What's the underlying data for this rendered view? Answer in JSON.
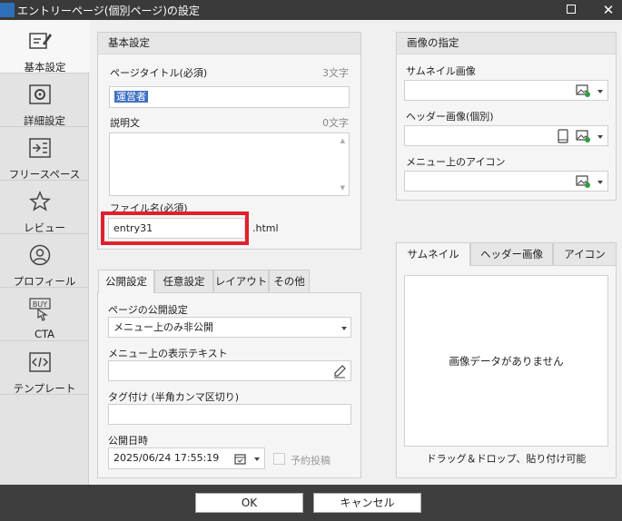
{
  "window": {
    "title": "エントリーページ(個別ページ)の設定"
  },
  "sidebar": {
    "items": [
      {
        "label": "基本設定"
      },
      {
        "label": "詳細設定"
      },
      {
        "label": "フリースペース"
      },
      {
        "label": "レビュー"
      },
      {
        "label": "プロフィール"
      },
      {
        "label": "CTA"
      },
      {
        "label": "テンプレート"
      }
    ]
  },
  "basic": {
    "heading": "基本設定",
    "page_title_label": "ページタイトル(必須)",
    "page_title_count": "3文字",
    "page_title_value": "運営者",
    "description_label": "説明文",
    "description_count": "0文字",
    "filename_label": "ファイル名(必須)",
    "filename_value": "entry31",
    "filename_ext": ".html"
  },
  "image": {
    "heading": "画像の指定",
    "thumbnail_label": "サムネイル画像",
    "header_label": "ヘッダー画像(個別)",
    "menu_icon_label": "メニュー上のアイコン"
  },
  "publish_tabs": [
    "公開設定",
    "任意設定",
    "レイアウト",
    "その他"
  ],
  "publish": {
    "visibility_label": "ページの公開設定",
    "visibility_value": "メニュー上のみ非公開",
    "menu_text_label": "メニュー上の表示テキスト",
    "tags_label": "タグ付け (半角カンマ区切り)",
    "date_label": "公開日時",
    "date_value": "2025/06/24 17:55:19",
    "scheduled_label": "予約投稿"
  },
  "preview_tabs": [
    "サムネイル",
    "ヘッダー画像",
    "アイコン"
  ],
  "preview": {
    "empty_text": "画像データがありません",
    "hint": "ドラッグ＆ドロップ、貼り付け可能"
  },
  "footer": {
    "ok_label": "OK",
    "cancel_label": "キャンセル"
  }
}
